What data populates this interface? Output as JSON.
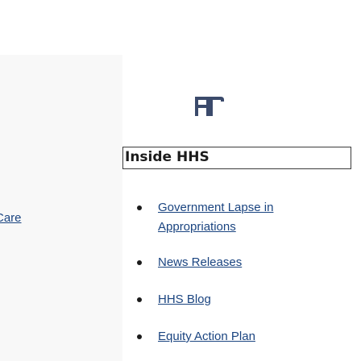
{
  "left_nav": {
    "partial_link": "Care"
  },
  "logo": {
    "name": "hhs-logo-icon",
    "color": "#3b4a6b"
  },
  "section": {
    "heading": "Inside HHS"
  },
  "links": [
    {
      "line1": "Government Lapse in",
      "line2": "Appropriations"
    },
    {
      "line1": "News Releases"
    },
    {
      "line1": "HHS Blog"
    },
    {
      "line1": "Equity Action Plan"
    }
  ],
  "colors": {
    "link": "#1a4480",
    "heading": "#1b1b1b",
    "panel_bg": "#f8f8f8"
  }
}
